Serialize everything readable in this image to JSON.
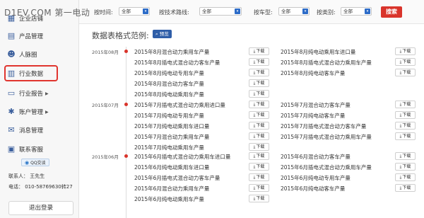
{
  "watermark": "D1EV.COM 第一电动",
  "sidebar": {
    "items": [
      {
        "label": "企业店铺",
        "icon": "store-icon",
        "glyph": "▦",
        "arrow": false
      },
      {
        "label": "产品管理",
        "icon": "product-icon",
        "glyph": "▤",
        "arrow": false
      },
      {
        "label": "人脉圈",
        "icon": "people-icon",
        "glyph": "☻",
        "arrow": false
      },
      {
        "label": "行业数据",
        "icon": "chart-icon",
        "glyph": "▥",
        "arrow": false
      },
      {
        "label": "行业报告",
        "icon": "report-icon",
        "glyph": "▭",
        "arrow": true
      },
      {
        "label": "账户管理",
        "icon": "gear-icon",
        "glyph": "✱",
        "arrow": true
      },
      {
        "label": "消息管理",
        "icon": "mail-icon",
        "glyph": "✉",
        "arrow": false
      },
      {
        "label": "联系客服",
        "icon": "service-icon",
        "glyph": "▣",
        "arrow": false
      }
    ],
    "qq_label": "QQ交谈",
    "contact_person": "联系人： 王先生",
    "contact_phone": "电话： 010-58769630转27",
    "logout": "退出登录"
  },
  "filters": {
    "time_label": "按时间:",
    "time_value": "全部",
    "route_label": "按技术路线:",
    "route_value": "全部",
    "model_label": "按车型:",
    "model_value": "全部",
    "category_label": "按类别:",
    "category_value": "全部",
    "search": "搜索"
  },
  "content": {
    "title": "数据表格式范例:",
    "preview": "预览",
    "download": "下载",
    "months": [
      {
        "label": "2015年08月",
        "left": [
          "2015年8月混合动力乘用车产量",
          "2015年8月插电式混合动力客车产量",
          "2015年8月纯电动专用车产量",
          "2015年8月混合动力客车产量",
          "2015年8月纯电动乘用车产量"
        ],
        "right": [
          "2015年8月纯电动乘用车进口量",
          "2015年8月插电式混合动力乘用车产量",
          "2015年8月纯电动客车产量"
        ]
      },
      {
        "label": "2015年07月",
        "left": [
          "2015年7月插电式混合动力乘用进口量",
          "2015年7月纯电动专用车产量",
          "2015年7月纯电动乘用车进口量",
          "2015年7月混合动力乘用车产量",
          "2015年7月纯电动乘用车产量"
        ],
        "right": [
          "2015年7月混合动力客车产量",
          "2015年7月纯电动客车产量",
          "2015年7月插电式混合动力客车产量",
          "2015年7月插电式混合动力乘用车产量"
        ]
      },
      {
        "label": "2015年06月",
        "left": [
          "2015年6月插电式混合动力乘用车进口量",
          "2015年6月纯电动乘用车进口量",
          "2015年6月插电式混合动力客车产量",
          "2015年6月混合动力乘用车产量",
          "2015年6月纯电动乘用车产量"
        ],
        "right": [
          "2015年6月混合动力客车产量",
          "2015年6月插电式混合动力乘用车产量",
          "2015年6月纯电动专用车产量",
          "2015年6月纯电动客车产量"
        ]
      }
    ]
  }
}
